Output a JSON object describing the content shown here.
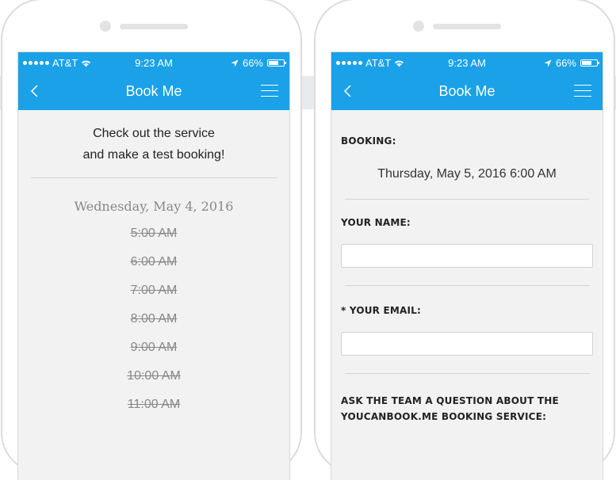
{
  "status_bar": {
    "carrier": "AT&T",
    "time": "9:23 AM",
    "battery": "66%"
  },
  "nav": {
    "title": "Book Me"
  },
  "intro": {
    "line1": "Check out the service",
    "line2": "and make a test booking!"
  },
  "schedule": {
    "date": "Wednesday, May 4, 2016",
    "slots": [
      "5:00 AM",
      "6:00 AM",
      "7:00 AM",
      "8:00 AM",
      "9:00 AM",
      "10:00 AM",
      "11:00 AM"
    ]
  },
  "form": {
    "booking_label": "BOOKING:",
    "booking_value": "Thursday, May 5, 2016 6:00 AM",
    "name_label": "YOUR NAME:",
    "name_value": "",
    "email_label": "* YOUR EMAIL:",
    "email_value": "",
    "question_label_line1": "ASK THE TEAM A QUESTION ABOUT THE",
    "question_label_line2": "YOUCANBOOK.ME BOOKING SERVICE:"
  },
  "colors": {
    "accent": "#1aa1e8",
    "screen_bg": "#f2f2f2"
  },
  "icons": {
    "back": "chevron-left-icon",
    "menu": "hamburger-menu-icon",
    "wifi": "wifi-icon",
    "location": "location-arrow-icon",
    "battery": "battery-icon"
  }
}
